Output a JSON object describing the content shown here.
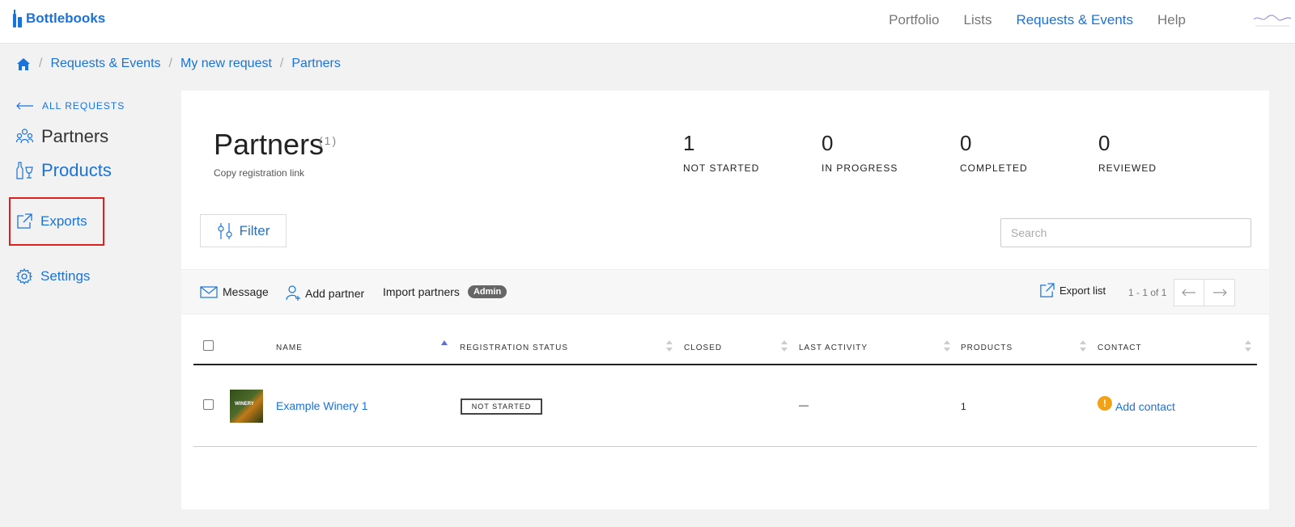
{
  "app": {
    "name": "Bottlebooks"
  },
  "nav": {
    "items": [
      "Portfolio",
      "Lists",
      "Requests & Events",
      "Help"
    ],
    "active": "Requests & Events"
  },
  "breadcrumb": [
    "Requests & Events",
    "My new request",
    "Partners"
  ],
  "sidebar": {
    "back_label": "ALL REQUESTS",
    "partners": "Partners",
    "products": "Products",
    "exports": "Exports",
    "settings": "Settings"
  },
  "header": {
    "title": "Partners",
    "count": "(1)",
    "copy_link": "Copy registration link"
  },
  "stats": [
    {
      "value": "1",
      "label": "NOT STARTED"
    },
    {
      "value": "0",
      "label": "IN PROGRESS"
    },
    {
      "value": "0",
      "label": "COMPLETED"
    },
    {
      "value": "0",
      "label": "REVIEWED"
    }
  ],
  "toolbar": {
    "filter_label": "Filter",
    "search_placeholder": "Search"
  },
  "actions": {
    "message": "Message",
    "add_partner": "Add partner",
    "import_partners": "Import partners",
    "admin_badge": "Admin",
    "export_list": "Export list",
    "pagination": "1 - 1 of 1"
  },
  "table": {
    "columns": [
      "NAME",
      "REGISTRATION STATUS",
      "CLOSED",
      "LAST ACTIVITY",
      "PRODUCTS",
      "CONTACT"
    ],
    "rows": [
      {
        "thumb_label": "WINERY",
        "name": "Example Winery 1",
        "status": "NOT STARTED",
        "closed": "",
        "last_activity": "—",
        "products": "1",
        "contact_warning": "!",
        "contact": "Add contact"
      }
    ]
  },
  "colors": {
    "accent": "#1a73d9",
    "highlight_box": "#e02020",
    "warning": "#f2a216",
    "sort_active": "#5b6fd6"
  }
}
